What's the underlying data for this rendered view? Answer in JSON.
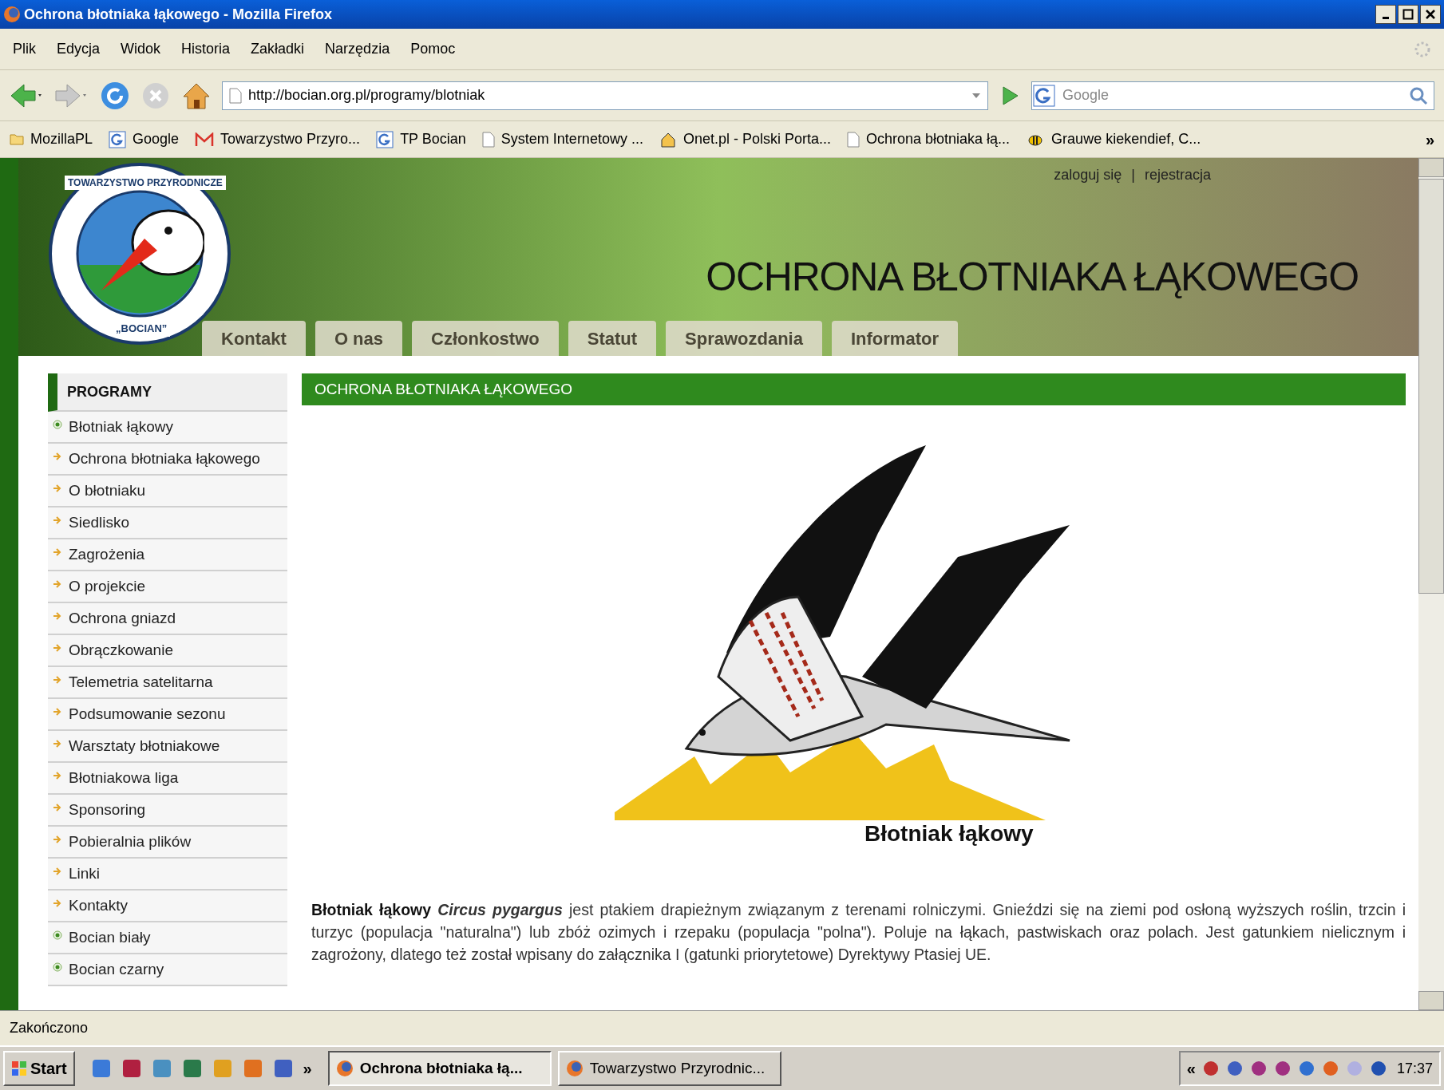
{
  "window": {
    "title": "Ochrona błotniaka łąkowego - Mozilla Firefox"
  },
  "menu": [
    "Plik",
    "Edycja",
    "Widok",
    "Historia",
    "Zakładki",
    "Narzędzia",
    "Pomoc"
  ],
  "address": {
    "value": "http://bocian.org.pl/programy/blotniak"
  },
  "search": {
    "placeholder": "Google"
  },
  "bookmarks": [
    {
      "label": "MozillaPL",
      "kind": "folder"
    },
    {
      "label": "Google",
      "kind": "g"
    },
    {
      "label": "Towarzystwo Przyro...",
      "kind": "mail"
    },
    {
      "label": "TP Bocian",
      "kind": "g"
    },
    {
      "label": "System Internetowy ...",
      "kind": "page"
    },
    {
      "label": "Onet.pl - Polski Porta...",
      "kind": "onet"
    },
    {
      "label": "Ochrona błotniaka łą...",
      "kind": "page"
    },
    {
      "label": "Grauwe kiekendief, C...",
      "kind": "bee"
    }
  ],
  "bookmarks_more": "»",
  "header": {
    "login": "zaloguj się",
    "separator": "|",
    "register": "rejestracja",
    "title": "OCHRONA BŁOTNIAKA ŁĄKOWEGO",
    "logo_top": "TOWARZYSTWO PRZYRODNICZE",
    "logo_bottom": "„BOCIAN”"
  },
  "tabs": [
    "Kontakt",
    "O nas",
    "Członkostwo",
    "Statut",
    "Sprawozdania",
    "Informator"
  ],
  "sidebar": {
    "title": "PROGRAMY",
    "items": [
      {
        "label": "Błotniak łąkowy",
        "kind": "dot"
      },
      {
        "label": "Ochrona błotniaka łąkowego",
        "kind": "arrow"
      },
      {
        "label": "O błotniaku",
        "kind": "arrow"
      },
      {
        "label": "Siedlisko",
        "kind": "arrow"
      },
      {
        "label": "Zagrożenia",
        "kind": "arrow"
      },
      {
        "label": "O projekcie",
        "kind": "arrow"
      },
      {
        "label": "Ochrona gniazd",
        "kind": "arrow"
      },
      {
        "label": "Obrączkowanie",
        "kind": "arrow"
      },
      {
        "label": "Telemetria satelitarna",
        "kind": "arrow"
      },
      {
        "label": "Podsumowanie sezonu",
        "kind": "arrow"
      },
      {
        "label": "Warsztaty błotniakowe",
        "kind": "arrow"
      },
      {
        "label": "Błotniakowa liga",
        "kind": "arrow"
      },
      {
        "label": "Sponsoring",
        "kind": "arrow"
      },
      {
        "label": "Pobieralnia plików",
        "kind": "arrow"
      },
      {
        "label": "Linki",
        "kind": "arrow"
      },
      {
        "label": "Kontakty",
        "kind": "arrow"
      },
      {
        "label": "Bocian biały",
        "kind": "dot"
      },
      {
        "label": "Bocian czarny",
        "kind": "dot"
      }
    ]
  },
  "main": {
    "heading": "OCHRONA BŁOTNIAKA ŁĄKOWEGO",
    "illustration_caption": "Błotniak łąkowy",
    "paragraph": "**Błotniak łąkowy** *Circus pygargus* jest ptakiem drapieżnym związanym z terenami rolniczymi. Gnieździ się na ziemi pod osłoną wyższych roślin, trzcin i turzyc (populacja \"naturalna\") lub zbóż ozimych i rzepaku (populacja \"polna\"). Poluje na łąkach, pastwiskach oraz polach. Jest gatunkiem nielicznym i zagrożony, dlatego też został wpisany do załącznika I (gatunki priorytetowe) Dyrektywy Ptasiej UE."
  },
  "status_bar": "Zakończono",
  "taskbar": {
    "start": "Start",
    "more": "»",
    "tasks": [
      {
        "label": "Ochrona błotniaka łą...",
        "selected": true
      },
      {
        "label": "Towarzystwo Przyrodnic...",
        "selected": false
      }
    ],
    "tray_more": "«",
    "clock": "17:37"
  }
}
